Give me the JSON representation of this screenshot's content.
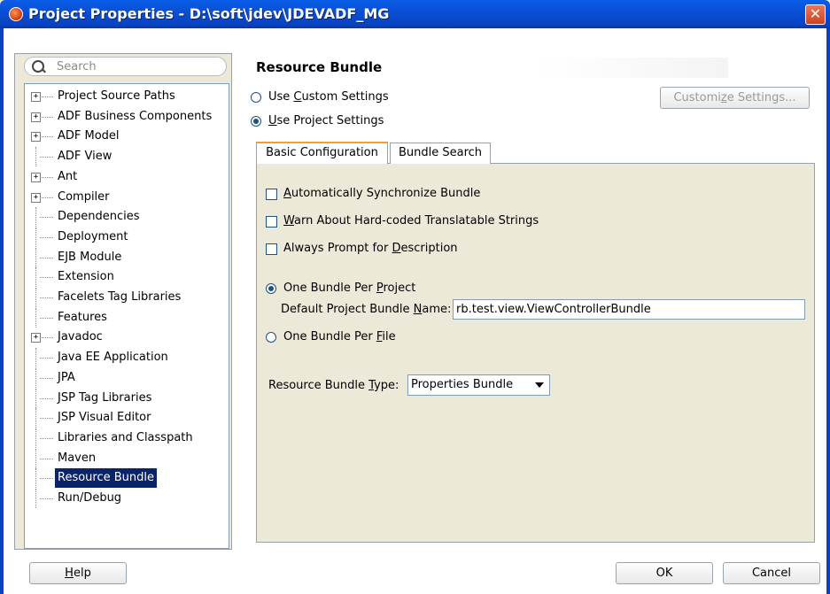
{
  "window": {
    "title": "Project Properties - D:\\soft\\jdev\\JDEVADF_MG",
    "close_glyph": "✕"
  },
  "search": {
    "placeholder": "Search"
  },
  "tree": [
    {
      "label": "Project Source Paths",
      "expandable": true
    },
    {
      "label": "ADF Business Components",
      "expandable": true
    },
    {
      "label": "ADF Model",
      "expandable": true
    },
    {
      "label": "ADF View",
      "expandable": false
    },
    {
      "label": "Ant",
      "expandable": true
    },
    {
      "label": "Compiler",
      "expandable": true
    },
    {
      "label": "Dependencies",
      "expandable": false
    },
    {
      "label": "Deployment",
      "expandable": false
    },
    {
      "label": "EJB Module",
      "expandable": false
    },
    {
      "label": "Extension",
      "expandable": false
    },
    {
      "label": "Facelets Tag Libraries",
      "expandable": false
    },
    {
      "label": "Features",
      "expandable": false
    },
    {
      "label": "Javadoc",
      "expandable": true
    },
    {
      "label": "Java EE Application",
      "expandable": false
    },
    {
      "label": "JPA",
      "expandable": false
    },
    {
      "label": "JSP Tag Libraries",
      "expandable": false
    },
    {
      "label": "JSP Visual Editor",
      "expandable": false
    },
    {
      "label": "Libraries and Classpath",
      "expandable": false
    },
    {
      "label": "Maven",
      "expandable": false
    },
    {
      "label": "Resource Bundle",
      "expandable": false,
      "selected": true
    },
    {
      "label": "Run/Debug",
      "expandable": false
    }
  ],
  "panel": {
    "title": "Resource Bundle",
    "use_custom_pre": "Use ",
    "use_custom_key": "C",
    "use_custom_post": "ustom Settings",
    "use_project_pre": "",
    "use_project_key": "U",
    "use_project_post": "se Project Settings",
    "customize_pre": "Customi",
    "customize_key": "z",
    "customize_post": "e Settings...",
    "tabs": [
      "Basic Configuration",
      "Bundle Search"
    ],
    "auto_sync_pre": "",
    "auto_sync_key": "A",
    "auto_sync_post": "utomatically Synchronize Bundle",
    "warn_pre": "",
    "warn_key": "W",
    "warn_post": "arn About Hard-coded Translatable Strings",
    "prompt_pre": "Always Prompt for ",
    "prompt_key": "D",
    "prompt_post": "escription",
    "one_per_project_pre": "One Bundle Per ",
    "one_per_project_key": "P",
    "one_per_project_post": "roject",
    "default_name_pre": "Default Project Bundle ",
    "default_name_key": "N",
    "default_name_post": "ame:",
    "default_name_value": "rb.test.view.ViewControllerBundle",
    "one_per_file_pre": "One Bundle Per ",
    "one_per_file_key": "F",
    "one_per_file_post": "ile",
    "type_pre": "Resource Bundle ",
    "type_key": "T",
    "type_post": "ype:",
    "type_value": "Properties Bundle"
  },
  "footer": {
    "help_key": "H",
    "help_post": "elp",
    "ok": "OK",
    "cancel": "Cancel"
  },
  "colors": {
    "title_bar": "#0a4fd6",
    "selection": "#0a246a",
    "tab_accent": "#f0a030",
    "close": "#d2421f"
  }
}
